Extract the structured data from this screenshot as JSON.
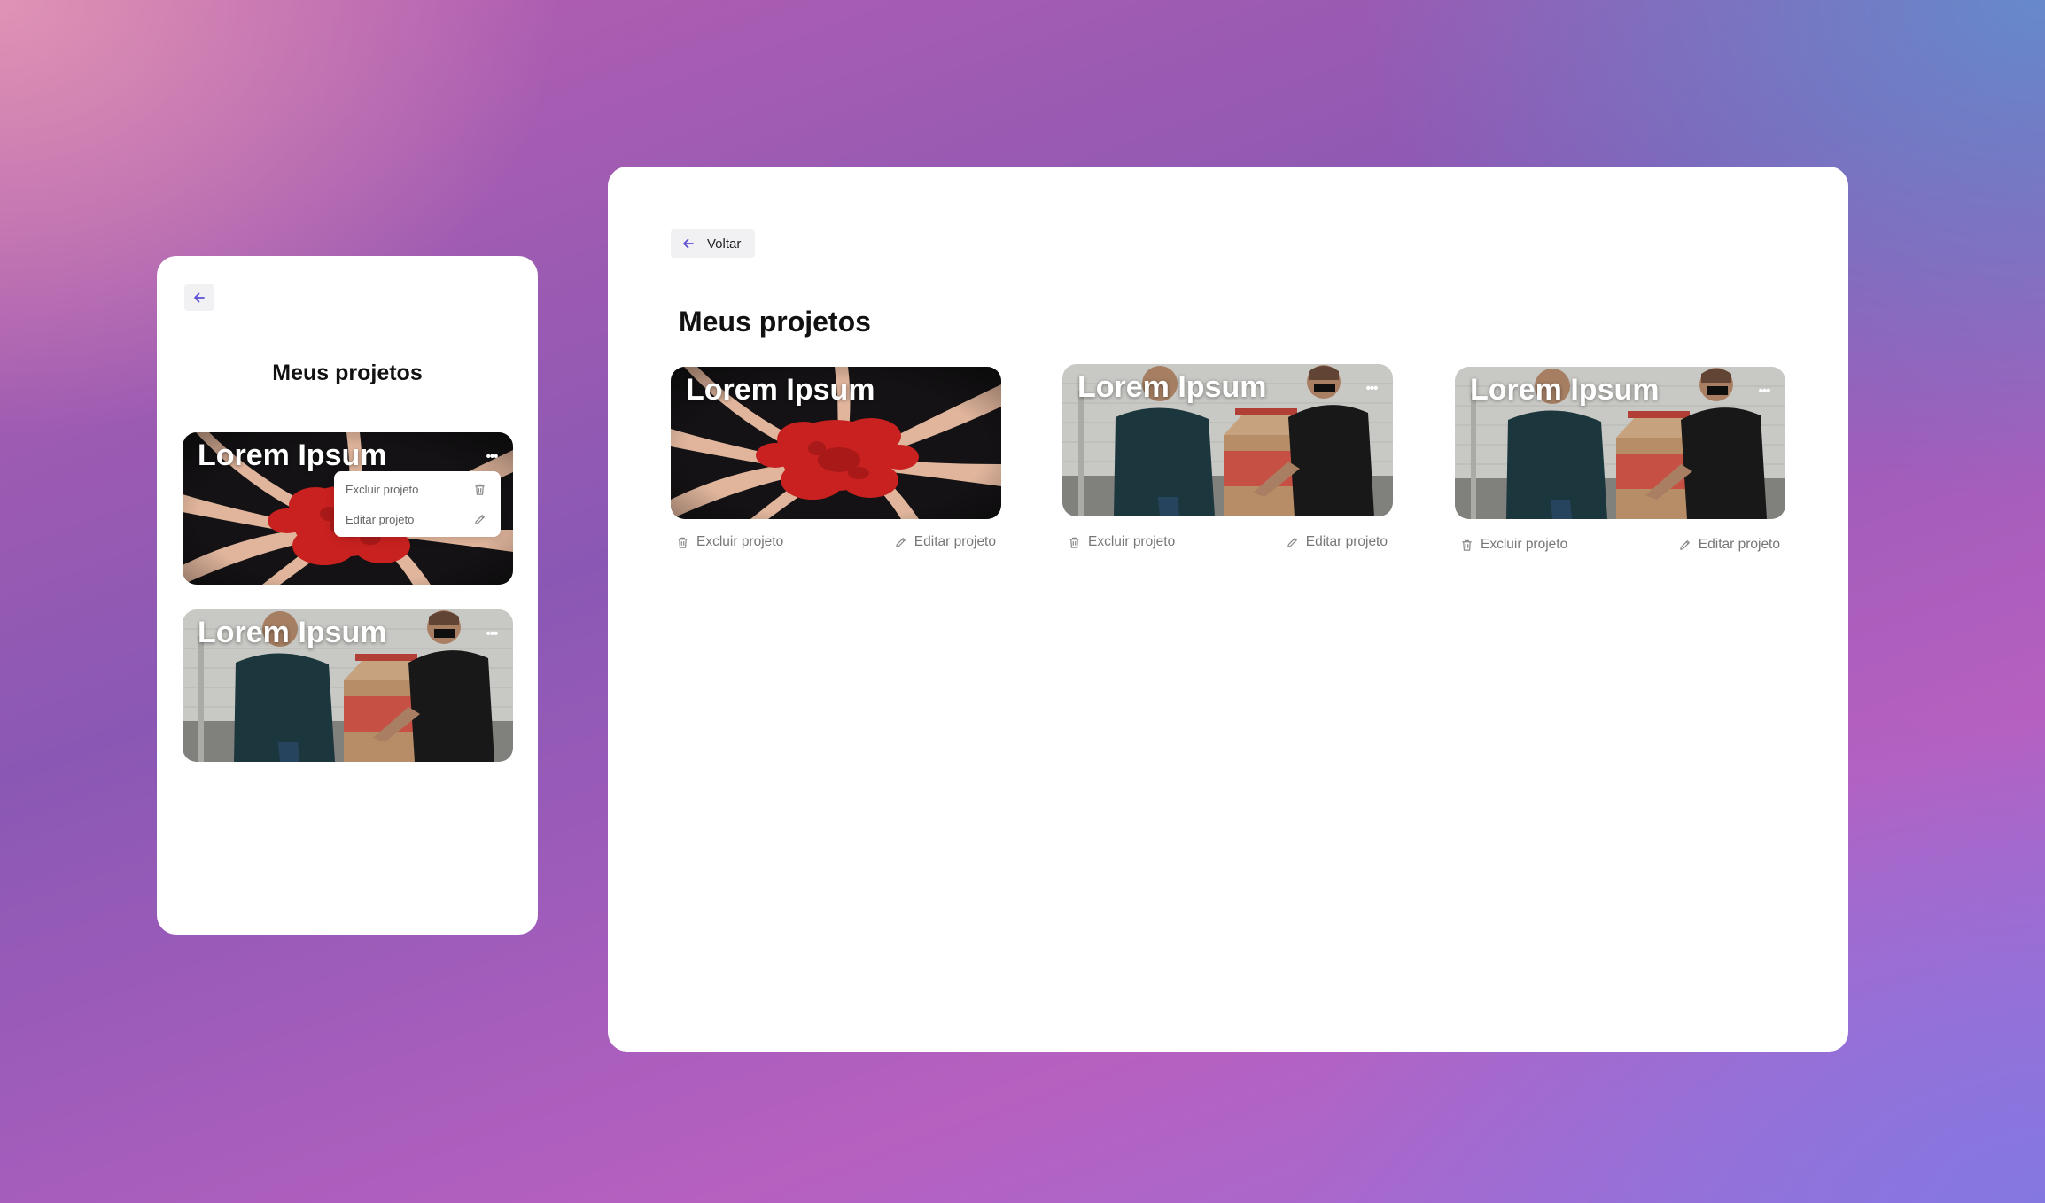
{
  "mobile": {
    "title": "Meus projetos",
    "back_icon": "arrow-left-icon",
    "projects": [
      {
        "title": "Lorem Ipsum",
        "image": "red-painted-hands-circle"
      },
      {
        "title": "Lorem Ipsum",
        "image": "volunteers-donation-boxes"
      }
    ],
    "context_menu": {
      "delete_label": "Excluir projeto",
      "edit_label": "Editar projeto"
    }
  },
  "desktop": {
    "back_label": "Voltar",
    "title": "Meus projetos",
    "projects": [
      {
        "title": "Lorem Ipsum",
        "image": "red-painted-hands-circle",
        "delete_label": "Excluir projeto",
        "edit_label": "Editar projeto"
      },
      {
        "title": "Lorem Ipsum",
        "image": "volunteers-donation-boxes",
        "delete_label": "Excluir projeto",
        "edit_label": "Editar projeto"
      },
      {
        "title": "Lorem Ipsum",
        "image": "volunteers-donation-boxes",
        "delete_label": "Excluir projeto",
        "edit_label": "Editar projeto"
      }
    ]
  },
  "colors": {
    "accent": "#5b4fd6",
    "card_title": "#ffffff",
    "action_text": "#777777"
  }
}
